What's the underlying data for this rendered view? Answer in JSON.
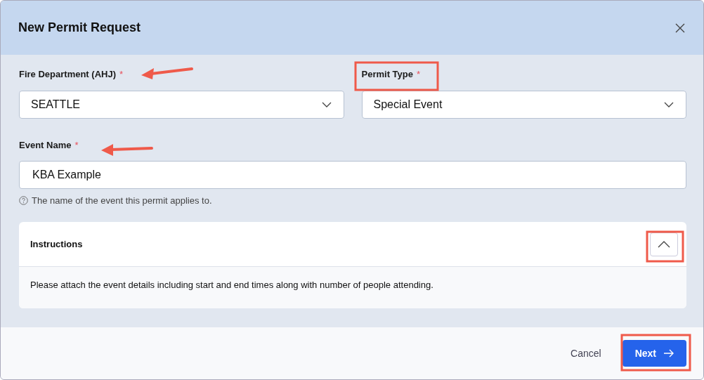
{
  "dialog": {
    "title": "New Permit Request"
  },
  "fields": [
    {
      "kind": "select",
      "label": "Fire Department (AHJ)",
      "required_mark": "*",
      "value": "SEATTLE"
    },
    {
      "kind": "select",
      "label": "Permit Type",
      "required_mark": "*",
      "value": "Special Event"
    },
    {
      "kind": "text",
      "label": "Event Name",
      "required_mark": "*",
      "value": "KBA Example",
      "help": "The name of the event this permit applies to."
    }
  ],
  "instructions": {
    "title": "Instructions",
    "expanded": true,
    "text": "Please attach the event details including start and end times along with number of people attending."
  },
  "footer": {
    "cancel": "Cancel",
    "next": "Next"
  }
}
